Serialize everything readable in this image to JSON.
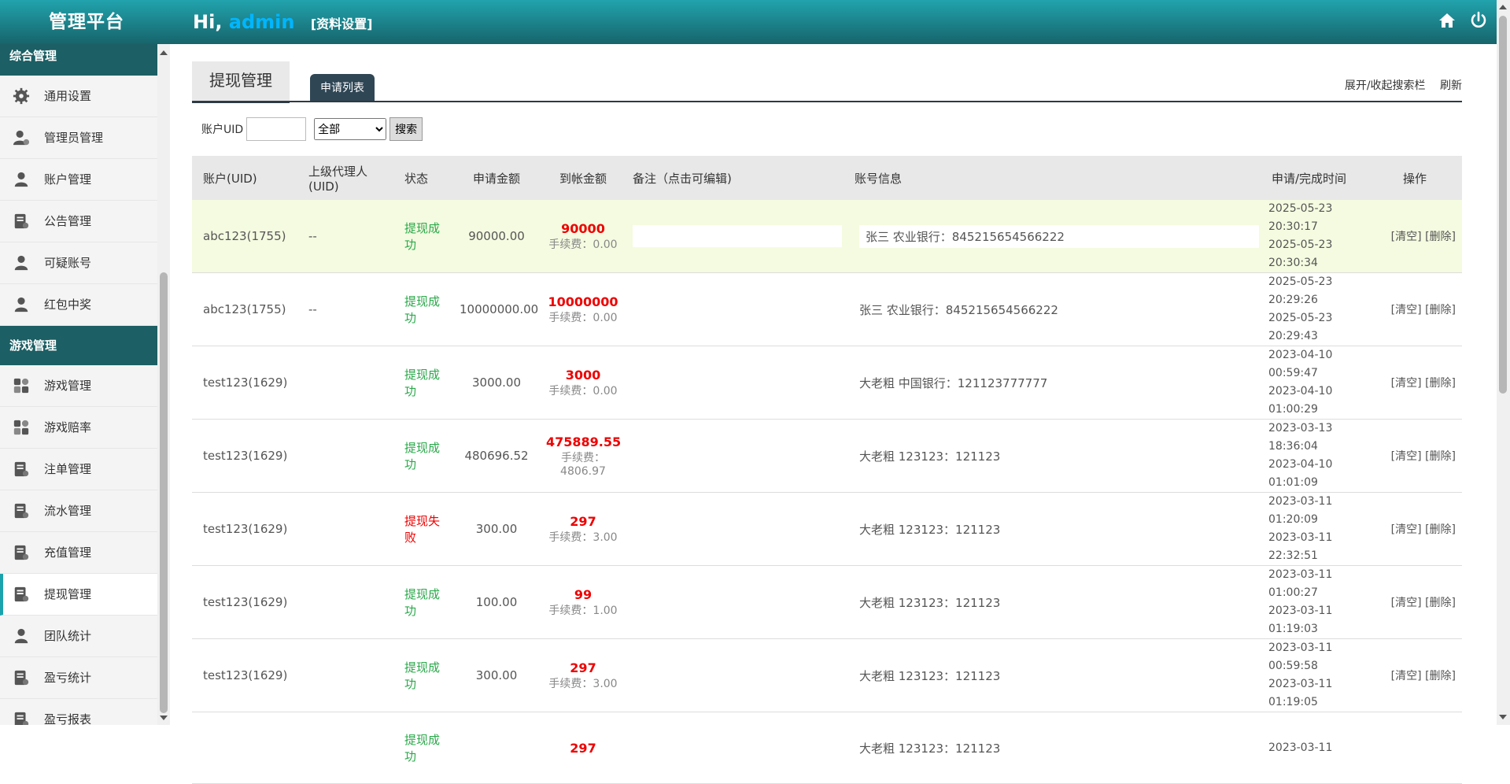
{
  "header": {
    "brand": "管理平台",
    "greeting": "Hi,",
    "username": "admin",
    "settings_link": "[资料设置]"
  },
  "sidebar": {
    "group1": "综合管理",
    "items1": [
      "通用设置",
      "管理员管理",
      "账户管理",
      "公告管理",
      "可疑账号",
      "红包中奖"
    ],
    "group2": "游戏管理",
    "items2": [
      "游戏管理",
      "游戏赔率",
      "注单管理",
      "流水管理",
      "充值管理",
      "提现管理",
      "团队统计",
      "盈亏统计",
      "盈亏报表"
    ]
  },
  "tabs": {
    "primary": "提现管理",
    "secondary": "申请列表"
  },
  "links": {
    "toggle": "展开/收起搜索栏",
    "refresh": "刷新"
  },
  "search": {
    "uid_label": "账户UID",
    "select_value": "全部",
    "button": "搜索"
  },
  "table": {
    "headers": [
      "账户(UID)",
      "上级代理人(UID)",
      "状态",
      "申请金额",
      "到帐金额",
      "备注（点击可编辑)",
      "账号信息",
      "申请/完成时间",
      "操作"
    ],
    "rows": [
      {
        "account": "abc123(1755)",
        "agent": "--",
        "status": "提现成功",
        "apply": "90000.00",
        "arrive": "90000",
        "fee": "手续费：0.00",
        "info": "张三 农业银行：845215654566222",
        "t1": "2025-05-23",
        "t2": "20:30:17",
        "t3": "2025-05-23",
        "t4": "20:30:34",
        "clear": "[清空]",
        "del": "[删除]"
      },
      {
        "account": "abc123(1755)",
        "agent": "--",
        "status": "提现成功",
        "apply": "10000000.00",
        "arrive": "10000000",
        "fee": "手续费：0.00",
        "info": "张三 农业银行：845215654566222",
        "t1": "2025-05-23",
        "t2": "20:29:26",
        "t3": "2025-05-23",
        "t4": "20:29:43",
        "clear": "[清空]",
        "del": "[删除]"
      },
      {
        "account": "test123(1629)",
        "agent": "",
        "status": "提现成功",
        "apply": "3000.00",
        "arrive": "3000",
        "fee": "手续费：0.00",
        "info": "大老粗 中国银行：121123777777",
        "t1": "2023-04-10",
        "t2": "00:59:47",
        "t3": "2023-04-10",
        "t4": "01:00:29",
        "clear": "[清空]",
        "del": "[删除]"
      },
      {
        "account": "test123(1629)",
        "agent": "",
        "status": "提现成功",
        "apply": "480696.52",
        "arrive": "475889.55",
        "fee": "手续费：4806.97",
        "info": "大老粗 123123：121123",
        "t1": "2023-03-13",
        "t2": "18:36:04",
        "t3": "2023-04-10",
        "t4": "01:01:09",
        "clear": "[清空]",
        "del": "[删除]"
      },
      {
        "account": "test123(1629)",
        "agent": "",
        "status": "提现失败",
        "apply": "300.00",
        "arrive": "297",
        "fee": "手续费：3.00",
        "info": "大老粗 123123：121123",
        "t1": "2023-03-11",
        "t2": "01:20:09",
        "t3": "2023-03-11",
        "t4": "22:32:51",
        "clear": "[清空]",
        "del": "[删除]"
      },
      {
        "account": "test123(1629)",
        "agent": "",
        "status": "提现成功",
        "apply": "100.00",
        "arrive": "99",
        "fee": "手续费：1.00",
        "info": "大老粗 123123：121123",
        "t1": "2023-03-11",
        "t2": "01:00:27",
        "t3": "2023-03-11",
        "t4": "01:19:03",
        "clear": "[清空]",
        "del": "[删除]"
      },
      {
        "account": "test123(1629)",
        "agent": "",
        "status": "提现成功",
        "apply": "300.00",
        "arrive": "297",
        "fee": "手续费：3.00",
        "info": "大老粗 123123：121123",
        "t1": "2023-03-11",
        "t2": "00:59:58",
        "t3": "2023-03-11",
        "t4": "01:19:05",
        "clear": "[清空]",
        "del": "[删除]"
      },
      {
        "account": "",
        "agent": "",
        "status": "提现成功",
        "apply": "",
        "arrive": "297",
        "fee": "",
        "info": "大老粗 123123：121123",
        "t1": "2023-03-11",
        "t2": "",
        "t3": "",
        "t4": "",
        "clear": "",
        "del": ""
      }
    ]
  },
  "colors": {
    "header_top": "#21a3ad",
    "header_bottom": "#17646b",
    "sidebar_group": "#1c5f64",
    "accent": "#1aa3ad",
    "success": "#2aa84a",
    "danger": "#e00000",
    "username": "#00b6ff"
  }
}
